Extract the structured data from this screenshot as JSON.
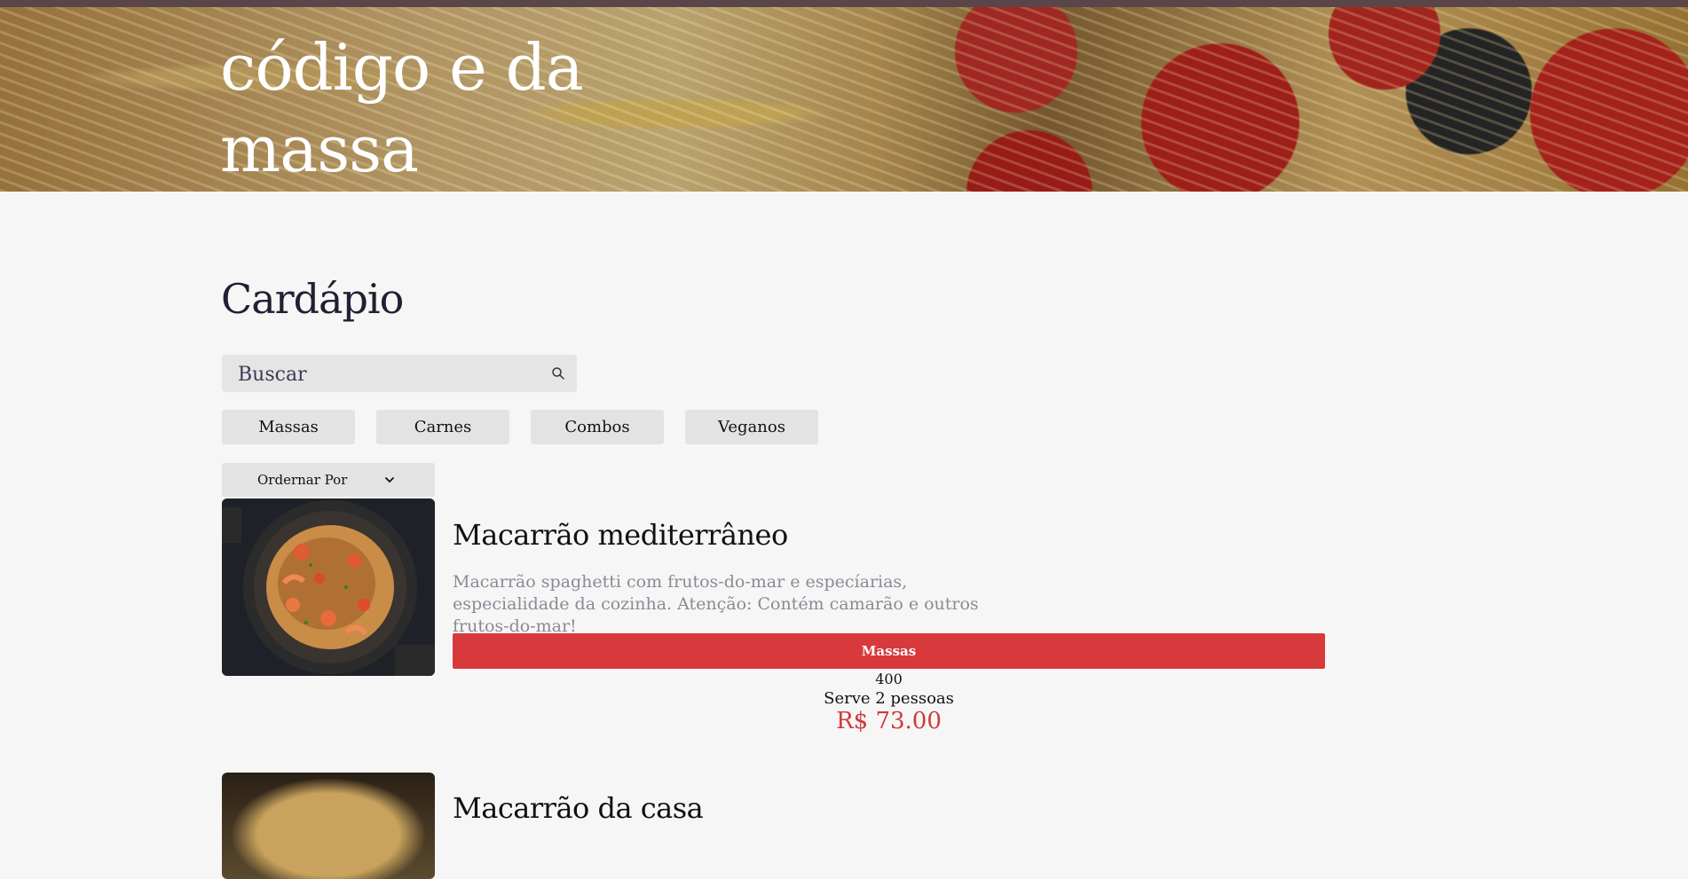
{
  "hero": {
    "title": "código e da massa"
  },
  "menu": {
    "title": "Cardápio",
    "search": {
      "placeholder": "Buscar"
    },
    "categories": [
      "Massas",
      "Carnes",
      "Combos",
      "Veganos"
    ],
    "sort": {
      "label": "Ordernar Por"
    }
  },
  "dishes": [
    {
      "name": "Macarrão mediterrâneo",
      "description": "Macarrão spaghetti com frutos-do-mar e especíarias, especialidade da cozinha. Atenção: Contém camarão e outros frutos-do-mar!",
      "category": "Massas",
      "weight": "400",
      "serves": "Serve 2 pessoas",
      "price": "R$ 73.00"
    },
    {
      "name": "Macarrão da casa"
    }
  ],
  "colors": {
    "accent": "#d8393d",
    "price": "#d0393d",
    "button_bg": "#e3e3e3",
    "page_bg": "#f6f6f6"
  },
  "icons": {
    "search": "search-icon",
    "sort": "chevron-down-icon"
  }
}
